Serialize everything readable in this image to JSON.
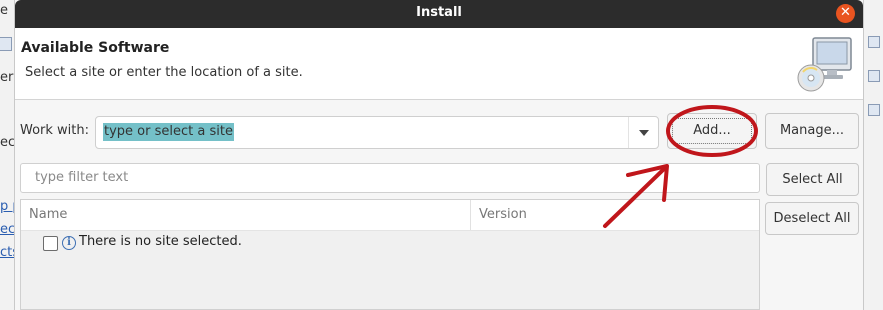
{
  "background": {
    "left_fragments": [
      "e",
      "er",
      "ect",
      "p pr",
      "ec",
      "cts"
    ],
    "right_fragments": [
      "(",
      "t"
    ]
  },
  "dialog": {
    "title": "Install",
    "close_icon": "close-icon",
    "heading": "Available Software",
    "subheading": "Select a site or enter the location of a site.",
    "banner_icon": "install-software-icon"
  },
  "work_with": {
    "label": "Work with:",
    "value": "type or select a site"
  },
  "buttons": {
    "add": "Add...",
    "manage": "Manage...",
    "select_all": "Select All",
    "deselect_all": "Deselect All"
  },
  "filter": {
    "placeholder": "type filter text"
  },
  "table": {
    "columns": [
      "Name",
      "Version"
    ],
    "rows": [
      {
        "checked": false,
        "icon": "info-icon",
        "text": "There is no site selected."
      }
    ]
  },
  "annotation": {
    "color": "#c0161b",
    "shapes": [
      "ellipse-around-add",
      "arrow-to-add"
    ]
  },
  "colors": {
    "titlebar": "#2c2c2c",
    "close": "#e95420",
    "selection": "#74c0c8"
  }
}
